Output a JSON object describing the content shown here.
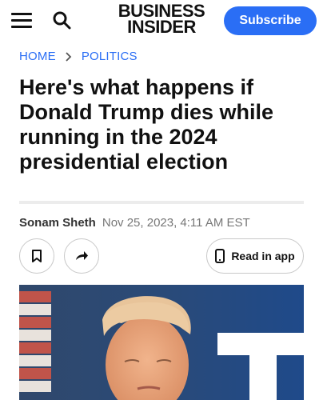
{
  "header": {
    "logo_line1": "BUSINESS",
    "logo_line2": "INSIDER",
    "subscribe_label": "Subscribe",
    "menu_icon": "hamburger-icon",
    "search_icon": "search-icon"
  },
  "breadcrumb": {
    "items": [
      "HOME",
      "POLITICS"
    ]
  },
  "article": {
    "title": "Here's what happens if Donald Trump dies while running in the 2024 presidential election",
    "author": "Sonam Sheth",
    "date": "Nov 25, 2023, 4:11 AM EST"
  },
  "actions": {
    "bookmark_icon": "bookmark-icon",
    "share_icon": "share-icon",
    "read_in_app_label": "Read in app",
    "phone_icon": "phone-icon"
  },
  "colors": {
    "accent": "#2a6ef5",
    "text": "#111111",
    "muted": "#777777",
    "divider": "#ececec",
    "hero_bg": "#243e63"
  }
}
